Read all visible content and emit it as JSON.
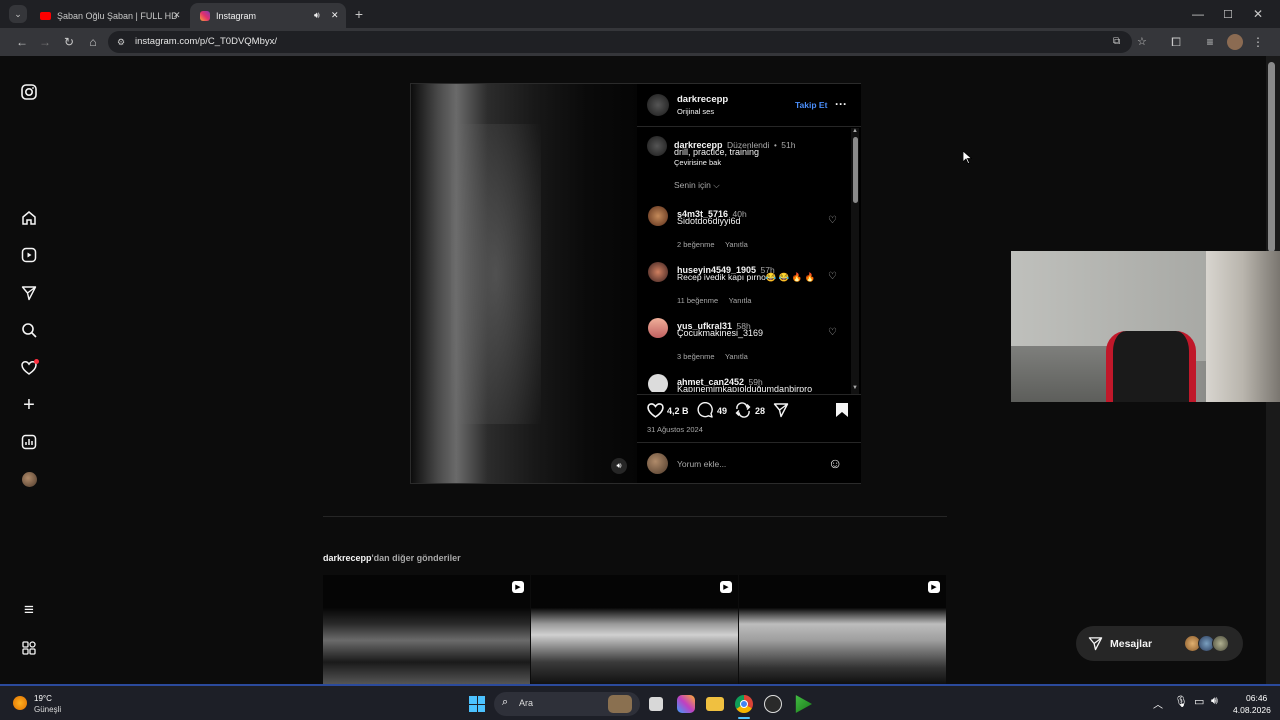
{
  "browser": {
    "tabs": [
      {
        "title": "Şaban Oğlu Şaban | FULL HD - Y",
        "close": "✕"
      },
      {
        "title": "Instagram",
        "close": "✕"
      }
    ],
    "new_tab": "+",
    "url": "instagram.com/p/C_T0DVQMbyx/"
  },
  "post": {
    "author": "darkrecepp",
    "audio": "Orijinal ses",
    "follow_label": "Takip Et",
    "more": "···",
    "caption_user": "darkrecepp",
    "caption_edited": "Düzenlendi",
    "caption_time": "51h",
    "caption_text": "drill, practice, training",
    "translate": "Çevirisine bak",
    "for_you": "Senin için",
    "comments": [
      {
        "user": "s4m3t_5716",
        "time": "40h",
        "text": "Sidotdo6diyyi6d",
        "likes": "2 beğenme",
        "reply": "Yanıtla"
      },
      {
        "user": "huseyin4549_1905",
        "time": "57h",
        "text": "Recep ivedik kapı pırno😂 😂 🔥 🔥",
        "likes": "11 beğenme",
        "reply": "Yanıtla"
      },
      {
        "user": "yus_ufkral31",
        "time": "58h",
        "text": "Çocukmakinesi_3169",
        "likes": "3 beğenme",
        "reply": "Yanıtla"
      },
      {
        "user": "ahmet_can2452",
        "time": "59h",
        "text": "Kapınemimkapıolduğumdanbirpro",
        "likes": "",
        "reply": ""
      }
    ],
    "likes_count": "4,2 B",
    "comments_count": "49",
    "reposts_count": "28",
    "date": "31 Ağustos 2024",
    "comment_placeholder": "Yorum ekle..."
  },
  "more_posts": {
    "user": "darkrecepp",
    "suffix": "'dan diğer gönderiler"
  },
  "messages": {
    "label": "Mesajlar"
  },
  "taskbar": {
    "weather_temp": "19°C",
    "weather_desc": "Güneşli",
    "search": "Ara",
    "time": "06:46",
    "date": "4.08.2026"
  },
  "colors": {
    "accent": "#4a8df8",
    "notification": "#ff3040"
  }
}
